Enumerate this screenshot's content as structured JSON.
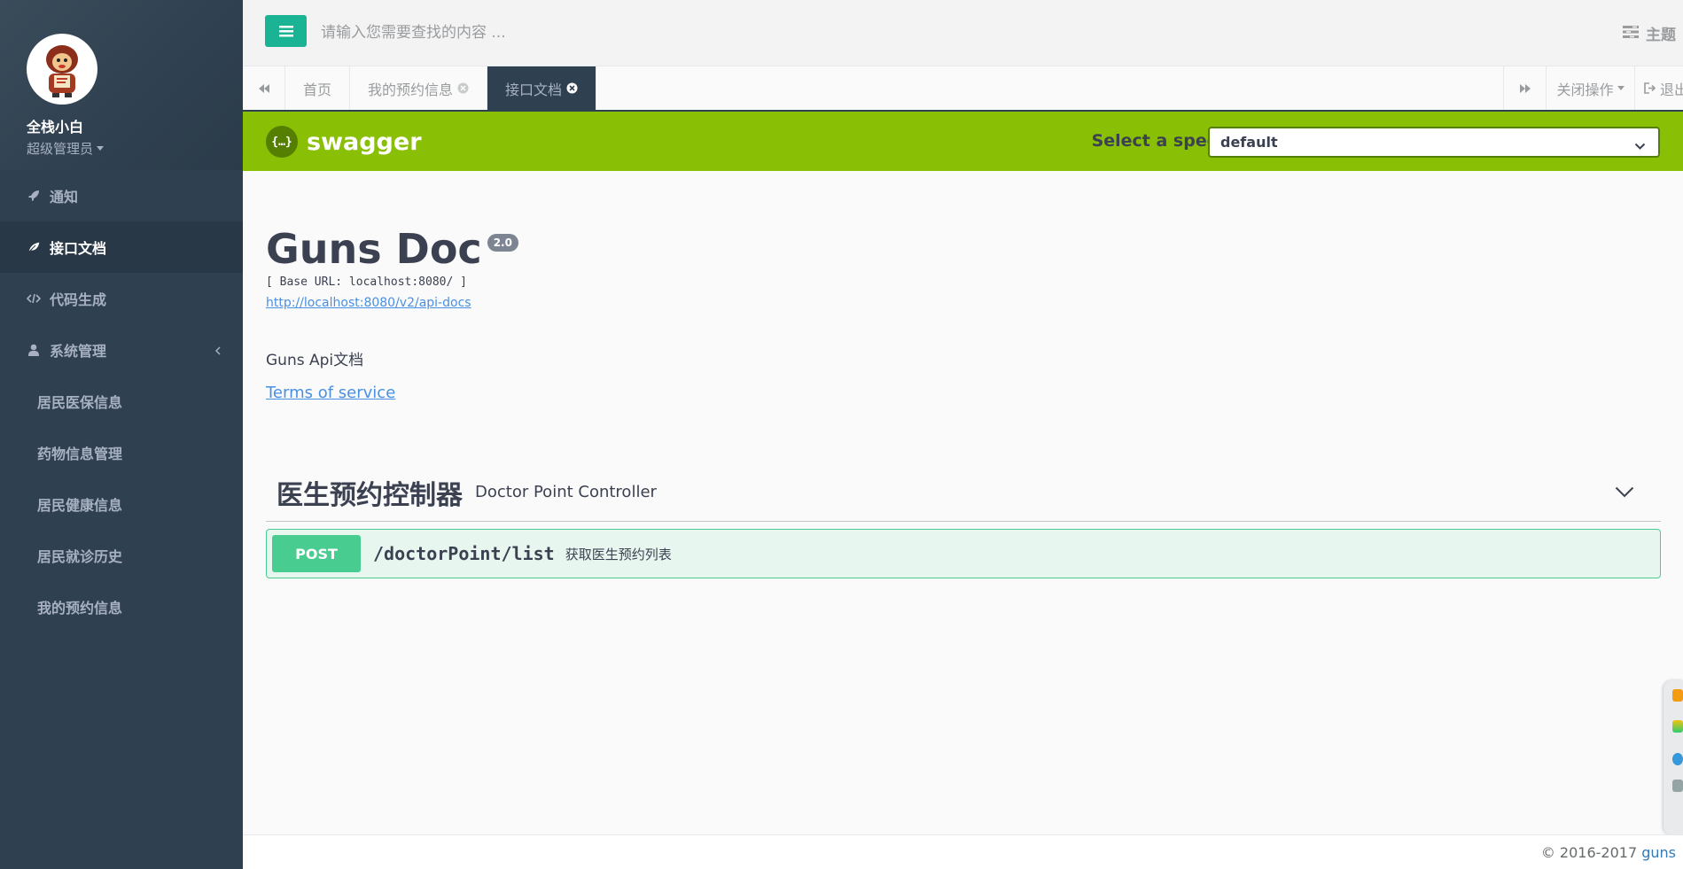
{
  "sidebar": {
    "profile": {
      "name": "全栈小白",
      "role": "超级管理员"
    },
    "items": [
      {
        "label": "通知",
        "icon": "rocket-icon"
      },
      {
        "label": "接口文档",
        "icon": "leaf-icon",
        "active": true
      },
      {
        "label": "代码生成",
        "icon": "code-icon"
      },
      {
        "label": "系统管理",
        "icon": "user-icon",
        "expanded": true
      }
    ],
    "sub_items": [
      {
        "label": "居民医保信息"
      },
      {
        "label": "药物信息管理"
      },
      {
        "label": "居民健康信息"
      },
      {
        "label": "居民就诊历史"
      },
      {
        "label": "我的预约信息"
      }
    ]
  },
  "topbar": {
    "search_placeholder": "请输入您需要查找的内容 ...",
    "theme_label": "主题"
  },
  "tabs": {
    "items": [
      {
        "label": "首页",
        "closable": false
      },
      {
        "label": "我的预约信息",
        "closable": true
      },
      {
        "label": "接口文档",
        "closable": true,
        "active": true
      }
    ],
    "close_ops_label": "关闭操作",
    "logout_label": "退出"
  },
  "swagger": {
    "brand": "swagger",
    "logo_glyph": "{…}",
    "spec_label": "Select a spec",
    "spec_value": "default",
    "title": "Guns Doc",
    "version": "2.0",
    "base_url": "[ Base URL: localhost:8080/ ]",
    "api_docs_link": "http://localhost:8080/v2/api-docs",
    "description": "Guns Api文档",
    "terms_label": "Terms of service",
    "tag": {
      "name": "医生预约控制器",
      "description": "Doctor Point Controller"
    },
    "operation": {
      "method": "POST",
      "path": "/doctorPoint/list",
      "summary": "获取医生预约列表"
    }
  },
  "footer": {
    "copyright": "© 2016-2017 ",
    "brand": "guns"
  },
  "colors": {
    "sidebar_bg": "#2f4050",
    "accent": "#1ab394",
    "swagger_green": "#89bf04",
    "post_green": "#49cc90",
    "link_blue": "#4990e2"
  }
}
